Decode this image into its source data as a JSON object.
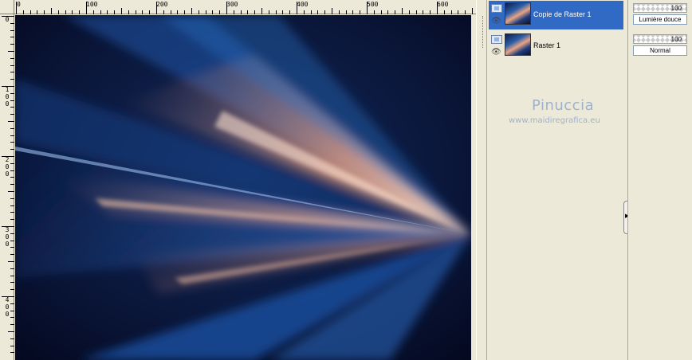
{
  "ruler": {
    "horizontal_labels": [
      "0",
      "100",
      "200",
      "300",
      "400",
      "500",
      "600"
    ],
    "vertical_labels": [
      "0",
      "100",
      "200",
      "300",
      "400"
    ]
  },
  "layers": [
    {
      "name": "Copie de Raster 1",
      "selected": true
    },
    {
      "name": "Raster 1",
      "selected": false
    }
  ],
  "watermark": {
    "name": "Pinuccia",
    "url": "www.maidiregrafica.eu"
  },
  "layer_properties": [
    {
      "opacity": "100",
      "blend_mode": "Lumière douce"
    },
    {
      "opacity": "100",
      "blend_mode": "Normal"
    }
  ],
  "colors": {
    "canvas_dark": "#060b24",
    "ray_blue": "#2a62b6",
    "ray_peach": "#f0b091",
    "selection": "#316ac5",
    "panel_bg": "#ece9d8"
  }
}
